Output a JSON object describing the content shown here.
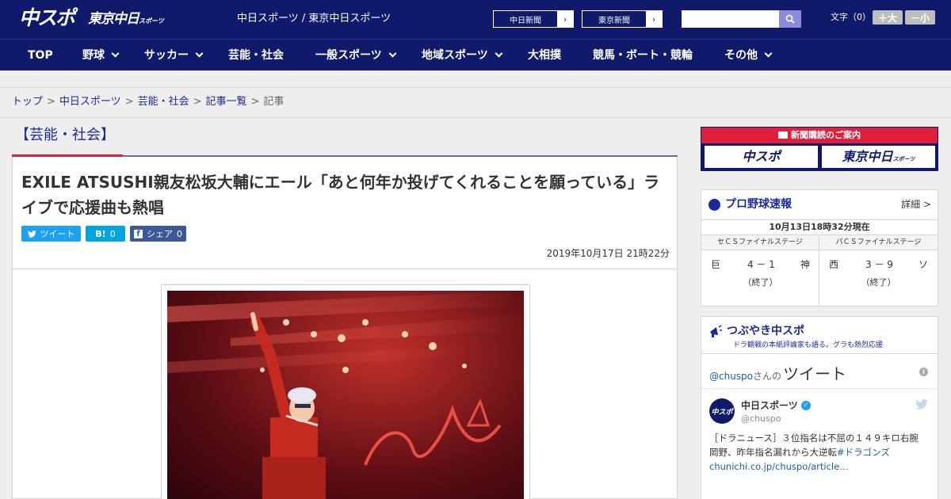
{
  "header": {
    "logo_chuspo": "中スポ",
    "logo_tokyo": "東京中日",
    "logo_tokyo_small": "スポーツ",
    "tagline": "中日スポーツ / 東京中日スポーツ",
    "paper_buttons": [
      "中日新聞",
      "東京新聞"
    ],
    "search_placeholder": "",
    "fontsize_label": "文字（0）",
    "font_larger": "＋大",
    "font_smaller": "－小"
  },
  "nav": {
    "items": [
      {
        "label": "TOP"
      },
      {
        "label": "野球"
      },
      {
        "label": "サッカー"
      },
      {
        "label": "芸能・社会"
      },
      {
        "label": "一般スポーツ"
      },
      {
        "label": "地域スポーツ"
      },
      {
        "label": "大相撲"
      },
      {
        "label": "競馬・ボート・競輪"
      },
      {
        "label": "その他"
      }
    ]
  },
  "breadcrumb": {
    "items": [
      "トップ",
      "中日スポーツ",
      "芸能・社会",
      "記事一覧"
    ],
    "separator": ">",
    "current": "記事"
  },
  "article": {
    "category": "【芸能・社会】",
    "headline": "EXILE ATSUSHI親友松坂大輔にエール「あと何年か投げてくれることを願っている」ライブで応援曲も熱唱",
    "share": {
      "tweet": "ツイート",
      "hatena": "B!",
      "hatena_count": "0",
      "facebook": "シェア",
      "facebook_count": "0"
    },
    "date": "2019年10月17日 21時22分"
  },
  "sidebar": {
    "subscribe": {
      "header": "新聞購読のご案内",
      "chuspo": "中スポ",
      "tokyo": "東京中日",
      "tokyo_small": "スポーツ"
    },
    "score": {
      "title": "プロ野球速報",
      "more": "詳細 >",
      "as_of": "10月13日18時32分現在",
      "games": [
        {
          "stage": "セＣＳファイナルステージ",
          "home": "巨",
          "score": "4 － 1",
          "away": "神",
          "status": "（終了）"
        },
        {
          "stage": "パＣＳファイナルステージ",
          "home": "西",
          "score": "3 － 9",
          "away": "ソ",
          "status": "（終了）"
        }
      ]
    },
    "tweets": {
      "title": "つぶやき中スポ",
      "subtitle": "ドラ観戦の本紙評論家も語る。グラも熱烈応援",
      "handle_prefix": "@chuspo",
      "handle_suffix": "さんの",
      "header_big": "ツイート",
      "account_name": "中日スポーツ",
      "account_handle": "@chuspo",
      "avatar_text": "中スポ",
      "text": "［ドラニュース］３位指名は不屈の１４９キロ右腕　岡野、昨年指名漏れから大逆転",
      "text_link": "#ドラゴンズchunichi.co.jp/chuspo/article…"
    }
  },
  "colors": {
    "brand_navy": "#0f1a6b",
    "accent_red": "#e0203a",
    "link_blue": "#1b2a9a",
    "twitter": "#1da1f2",
    "hatena": "#00a4de",
    "facebook": "#3b5998"
  }
}
